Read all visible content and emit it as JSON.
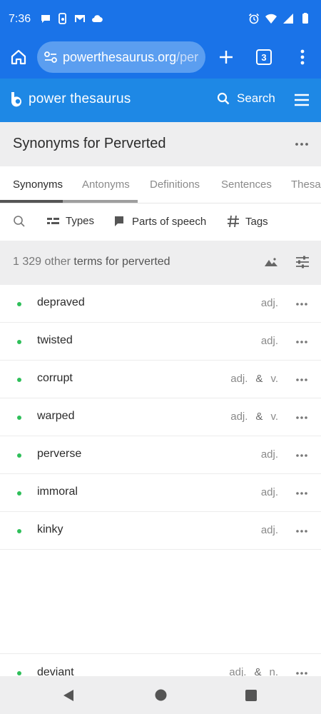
{
  "status_bar": {
    "time": "7:36",
    "left_icons": [
      "chat-icon",
      "phone-sync-icon",
      "gmail-icon",
      "cloud-icon"
    ],
    "right_icons": [
      "alarm-icon",
      "wifi-icon",
      "signal-icon",
      "battery-icon"
    ]
  },
  "browser": {
    "url_main": "powerthesaurus.org",
    "url_rest": "/per",
    "tab_count": "3"
  },
  "site": {
    "brand": "power thesaurus",
    "search_label": "Search"
  },
  "page": {
    "title": "Synonyms for Perverted"
  },
  "tabs": [
    {
      "label": "Synonyms",
      "active": true
    },
    {
      "label": "Antonyms"
    },
    {
      "label": "Definitions"
    },
    {
      "label": "Sentences"
    },
    {
      "label": "Thesa"
    }
  ],
  "filters": {
    "types": "Types",
    "parts_of_speech": "Parts of speech",
    "tags": "Tags"
  },
  "summary": {
    "count": "1 329",
    "count_mid": " other ",
    "count_tail": "terms for perverted"
  },
  "words": [
    {
      "word": "depraved",
      "pos": [
        "adj."
      ]
    },
    {
      "word": "twisted",
      "pos": [
        "adj."
      ]
    },
    {
      "word": "corrupt",
      "pos": [
        "adj.",
        "v."
      ]
    },
    {
      "word": "warped",
      "pos": [
        "adj.",
        "v."
      ]
    },
    {
      "word": "perverse",
      "pos": [
        "adj."
      ]
    },
    {
      "word": "immoral",
      "pos": [
        "adj."
      ]
    },
    {
      "word": "kinky",
      "pos": [
        "adj."
      ]
    },
    {
      "word": "deviant",
      "pos": [
        "adj.",
        "n."
      ]
    }
  ],
  "pos_separator": "&",
  "colors": {
    "chrome_blue": "#1a73e8",
    "site_blue": "#1e88e5",
    "accent_green": "#2fbf5a"
  }
}
